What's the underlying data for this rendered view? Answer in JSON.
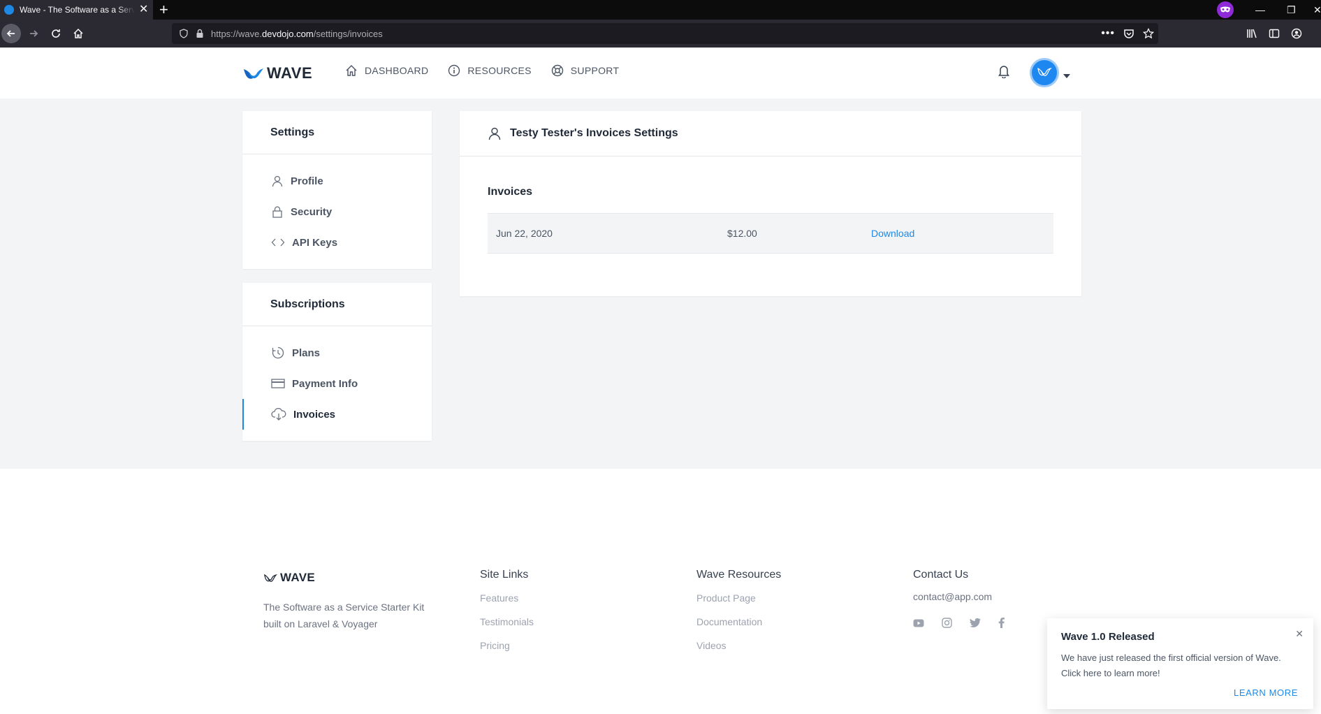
{
  "browser": {
    "tab_title": "Wave - The Software as a Service Starter Kit",
    "url_prefix": "https://wave.",
    "url_domain": "devdojo.com",
    "url_path": "/settings/invoices"
  },
  "header": {
    "logo_text": "WAVE",
    "nav": [
      {
        "label": "DASHBOARD",
        "icon": "home-icon"
      },
      {
        "label": "RESOURCES",
        "icon": "info-icon"
      },
      {
        "label": "SUPPORT",
        "icon": "lifebuoy-icon"
      }
    ]
  },
  "sidebar": {
    "settings_title": "Settings",
    "settings_items": [
      {
        "label": "Profile",
        "icon": "user-icon"
      },
      {
        "label": "Security",
        "icon": "lock-icon"
      },
      {
        "label": "API Keys",
        "icon": "code-icon"
      }
    ],
    "subscriptions_title": "Subscriptions",
    "subscription_items": [
      {
        "label": "Plans",
        "icon": "clock-icon"
      },
      {
        "label": "Payment Info",
        "icon": "credit-card-icon"
      },
      {
        "label": "Invoices",
        "icon": "cloud-download-icon",
        "active": true
      }
    ]
  },
  "content": {
    "title": "Testy Tester's Invoices Settings",
    "section_title": "Invoices",
    "invoices": [
      {
        "date": "Jun 22, 2020",
        "amount": "$12.00",
        "action": "Download"
      }
    ]
  },
  "footer": {
    "logo_text": "WAVE",
    "tagline": "The Software as a Service Starter Kit built on Laravel & Voyager",
    "site_links_title": "Site Links",
    "site_links": [
      "Features",
      "Testimonials",
      "Pricing"
    ],
    "resources_title": "Wave Resources",
    "resources": [
      "Product Page",
      "Documentation",
      "Videos"
    ],
    "contact_title": "Contact Us",
    "contact_email": "contact@app.com",
    "social": [
      "youtube-icon",
      "instagram-icon",
      "twitter-icon",
      "facebook-icon"
    ]
  },
  "toast": {
    "title": "Wave 1.0 Released",
    "body": "We have just released the first official version of Wave. Click here to learn more!",
    "action": "LEARN MORE",
    "close": "✕"
  },
  "colors": {
    "accent": "#1e88e5",
    "page_bg": "#f3f4f6"
  }
}
